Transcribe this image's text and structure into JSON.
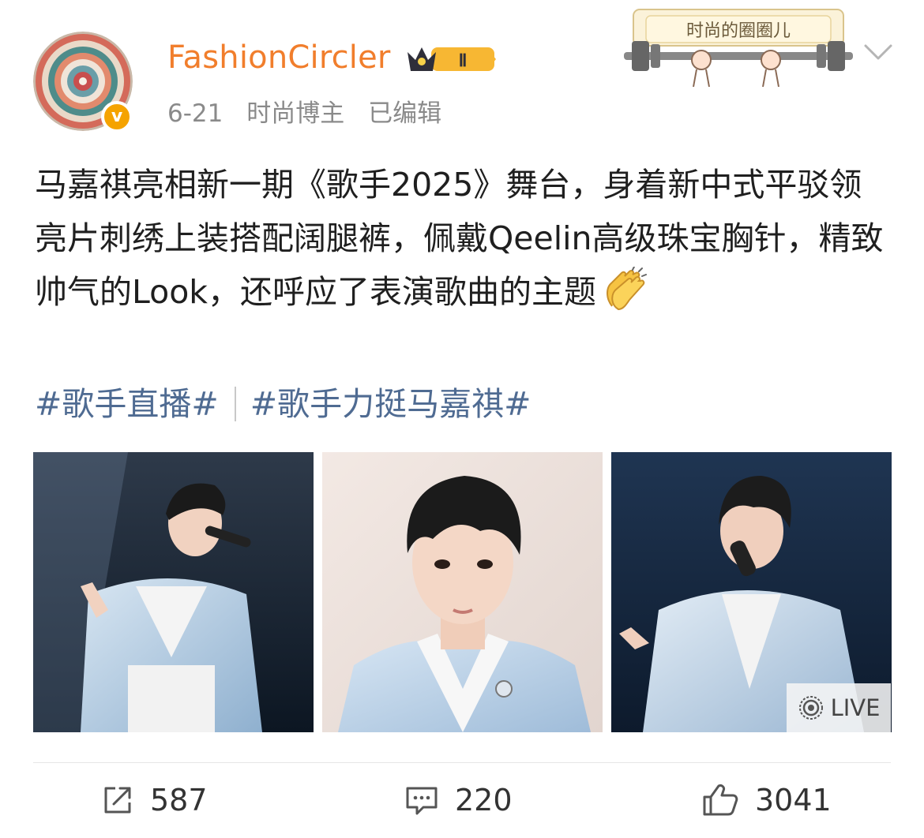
{
  "post": {
    "username": "FashionCircler",
    "level_badge": "Ⅱ",
    "verified_badge": "v",
    "date": "6-21",
    "role": "时尚博主",
    "edited": "已编辑",
    "sticker_text": "时尚的圈圈儿",
    "text": "马嘉祺亮相新一期《歌手2025》舞台，身着新中式平驳领亮片刺绣上装搭配阔腿裤，佩戴Qeelin高级珠宝胸针，精致帅气的Look，还呼应了表演歌曲的主题",
    "hashtags": [
      "#歌手直播#",
      "#歌手力挺马嘉祺#"
    ],
    "photos": [
      {
        "icon": "singer-stage-photo"
      },
      {
        "icon": "portrait-photo"
      },
      {
        "icon": "singer-live-photo",
        "badge": "LIVE"
      }
    ]
  },
  "actions": {
    "repost_count": "587",
    "comment_count": "220",
    "like_count": "3041"
  },
  "colors": {
    "username": "#f17e2c",
    "hashtag": "#4f6b92",
    "meta": "#8a8a8a",
    "badge": "#f5a300"
  }
}
